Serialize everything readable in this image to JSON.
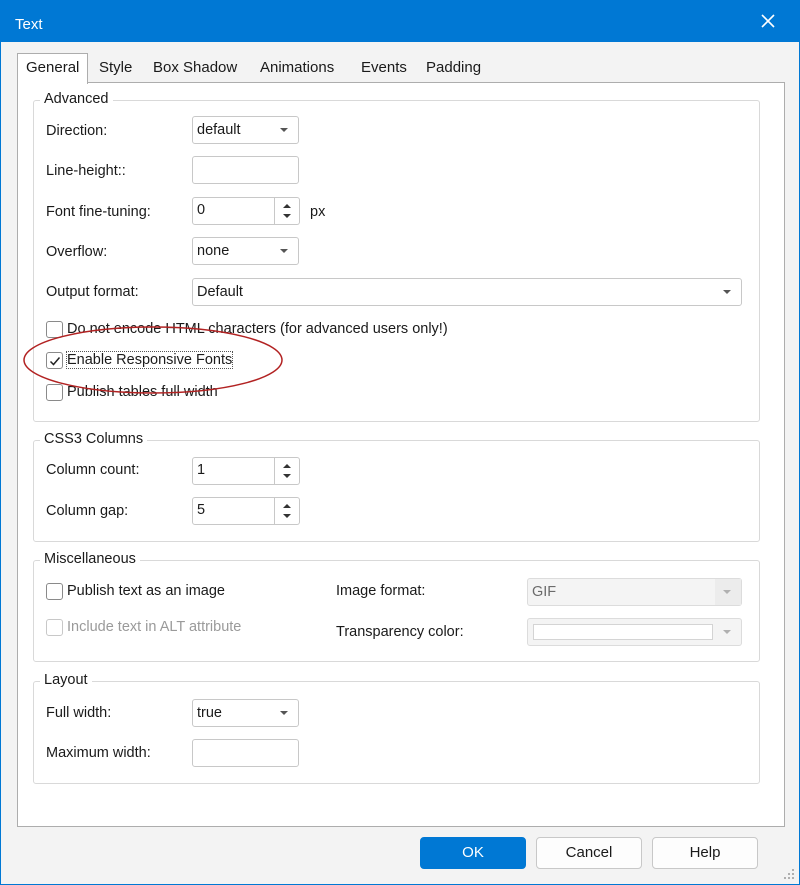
{
  "window": {
    "title": "Text"
  },
  "tabs": [
    {
      "label": "General"
    },
    {
      "label": "Style"
    },
    {
      "label": "Box Shadow"
    },
    {
      "label": "Animations"
    },
    {
      "label": "Events"
    },
    {
      "label": "Padding"
    }
  ],
  "active_tab": "General",
  "advanced": {
    "title": "Advanced",
    "direction_label": "Direction:",
    "direction_value": "default",
    "line_height_label": "Line-height::",
    "line_height_value": "",
    "font_tuning_label": "Font fine-tuning:",
    "font_tuning_value": "0",
    "font_tuning_unit": "px",
    "overflow_label": "Overflow:",
    "overflow_value": "none",
    "output_format_label": "Output format:",
    "output_format_value": "Default",
    "no_encode_label": "Do not encode HTML characters (for advanced users only!)",
    "no_encode_checked": false,
    "responsive_fonts_label": "Enable Responsive Fonts",
    "responsive_fonts_checked": true,
    "publish_tables_label": "Publish tables full width",
    "publish_tables_checked": false
  },
  "css3": {
    "title": "CSS3 Columns",
    "column_count_label": "Column count:",
    "column_count_value": "1",
    "column_gap_label": "Column gap:",
    "column_gap_value": "5"
  },
  "misc": {
    "title": "Miscellaneous",
    "publish_image_label": "Publish text as an image",
    "publish_image_checked": false,
    "include_alt_label": "Include text in ALT attribute",
    "include_alt_checked": false,
    "image_format_label": "Image format:",
    "image_format_value": "GIF",
    "transparency_label": "Transparency color:",
    "transparency_value": ""
  },
  "layout": {
    "title": "Layout",
    "full_width_label": "Full width:",
    "full_width_value": "true",
    "max_width_label": "Maximum width:",
    "max_width_value": ""
  },
  "buttons": {
    "ok": "OK",
    "cancel": "Cancel",
    "help": "Help"
  },
  "colors": {
    "accent": "#0078d4",
    "annotation": "#b22222"
  },
  "icons": {
    "close": "close-icon",
    "check": "checkmark-icon",
    "resize": "resize-grip-icon"
  }
}
